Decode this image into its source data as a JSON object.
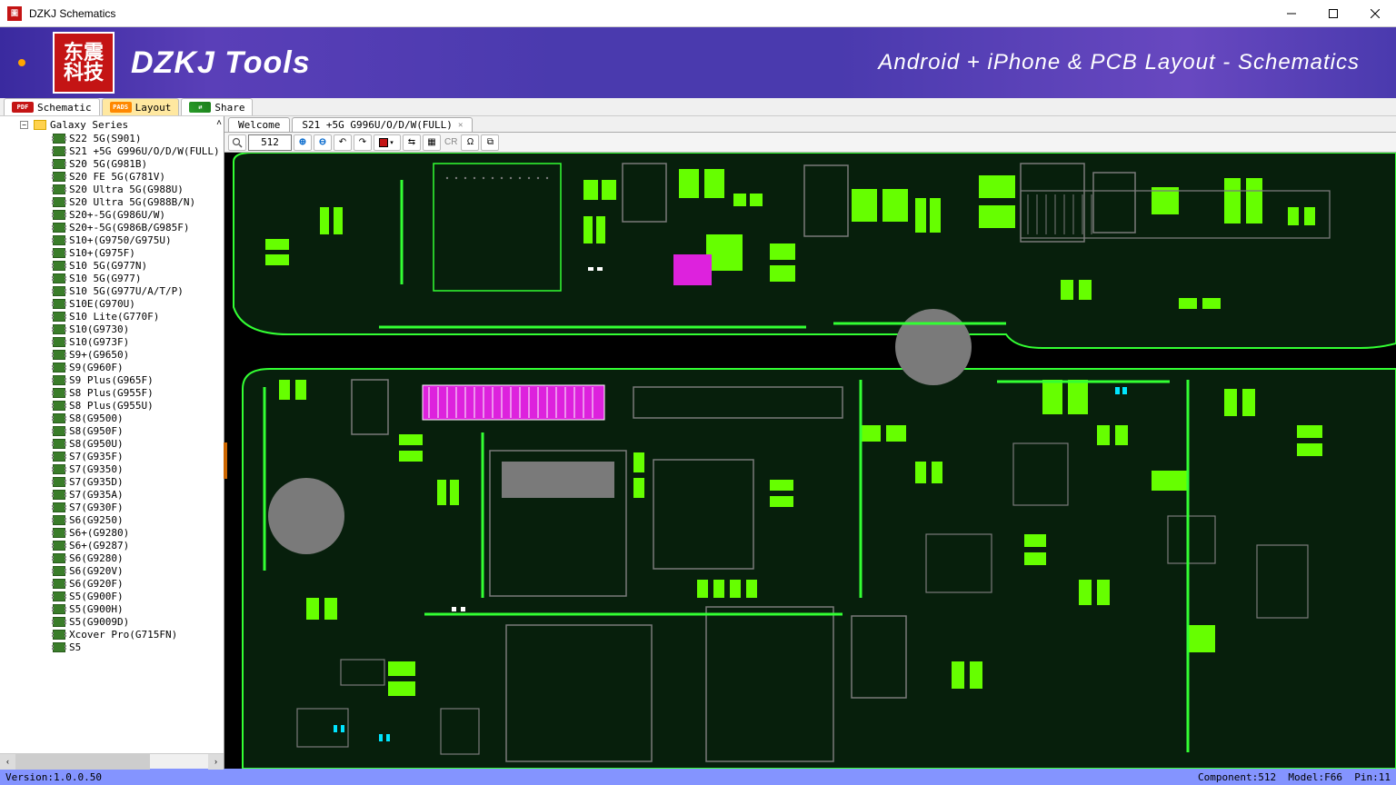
{
  "window": {
    "title": "DZKJ Schematics"
  },
  "banner": {
    "logo_cn_top": "东震",
    "logo_cn_bot": "科技",
    "brand": "DZKJ Tools",
    "tagline": "Android + iPhone & PCB Layout - Schematics"
  },
  "sidebar_tabs": {
    "schematic": "Schematic",
    "schematic_badge": "PDF",
    "layout": "Layout",
    "layout_badge": "PADS",
    "share": "Share"
  },
  "tree": {
    "root": "Galaxy Series",
    "items": [
      "S22 5G(S901)",
      "S21 +5G G996U/O/D/W(FULL)",
      "S20 5G(G981B)",
      "S20 FE 5G(G781V)",
      "S20 Ultra 5G(G988U)",
      "S20 Ultra 5G(G988B/N)",
      "S20+-5G(G986U/W)",
      "S20+-5G(G986B/G985F)",
      "S10+(G9750/G975U)",
      "S10+(G975F)",
      "S10 5G(G977N)",
      "S10 5G(G977)",
      "S10 5G(G977U/A/T/P)",
      "S10E(G970U)",
      "S10 Lite(G770F)",
      "S10(G9730)",
      "S10(G973F)",
      "S9+(G9650)",
      "S9(G960F)",
      "S9 Plus(G965F)",
      "S8 Plus(G955F)",
      "S8 Plus(G955U)",
      "S8(G9500)",
      "S8(G950F)",
      "S8(G950U)",
      "S7(G935F)",
      "S7(G9350)",
      "S7(G935D)",
      "S7(G935A)",
      "S7(G930F)",
      "S6(G9250)",
      "S6+(G9280)",
      "S6+(G9287)",
      "S6(G9280)",
      "S6(G920V)",
      "S6(G920F)",
      "S5(G900F)",
      "S5(G900H)",
      "S5(G9009D)",
      "Xcover Pro(G715FN)",
      "S5"
    ]
  },
  "doc_tabs": {
    "welcome": "Welcome",
    "active": "S21 +5G G996U/O/D/W(FULL)"
  },
  "toolbar": {
    "zoom_value": "512",
    "cr": "CR"
  },
  "status": {
    "version_label": "Version:",
    "version": "1.0.0.50",
    "component_label": "Component:",
    "component": "512",
    "model_label": "Model:",
    "model": "F66",
    "pin_label": "Pin:",
    "pin": "11"
  }
}
